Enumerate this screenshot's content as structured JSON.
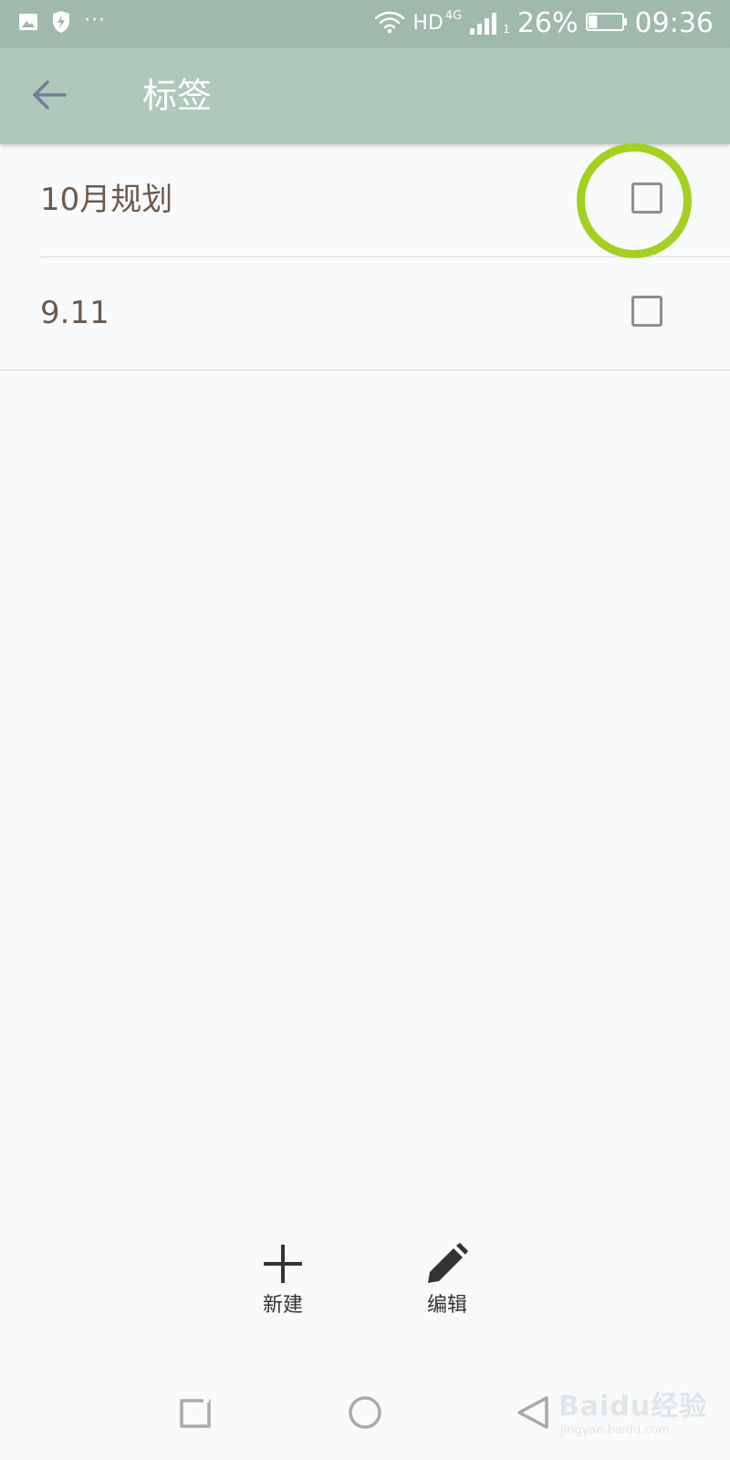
{
  "status_bar": {
    "overflow_dots": "···",
    "network": "HD",
    "network_gen": "4G",
    "sim_slot": "1",
    "battery_percent": "26%",
    "battery_level": 0.26,
    "time": "09:36",
    "icons": [
      "image-icon",
      "shield-bolt-icon",
      "wifi-icon",
      "signal-icon",
      "battery-icon"
    ]
  },
  "app_bar": {
    "title": "标签",
    "back_icon": "arrow-left-icon"
  },
  "tags": [
    {
      "label": "10月规划",
      "checked": false
    },
    {
      "label": "9.11",
      "checked": false
    }
  ],
  "toolbar": {
    "new_label": "新建",
    "new_icon": "plus-icon",
    "edit_label": "编辑",
    "edit_icon": "pencil-icon"
  },
  "nav_bar": {
    "icons": [
      "recent-apps-icon",
      "home-icon",
      "back-triangle-icon"
    ]
  },
  "watermark": {
    "main": "Baidu经验",
    "sub": "jingyan.baidu.com"
  },
  "colors": {
    "status_bar_bg": "#9fb9ac",
    "app_bar_bg": "#afc8bc",
    "highlight_ring": "#a3d021",
    "tag_text": "#6b5a4c"
  }
}
